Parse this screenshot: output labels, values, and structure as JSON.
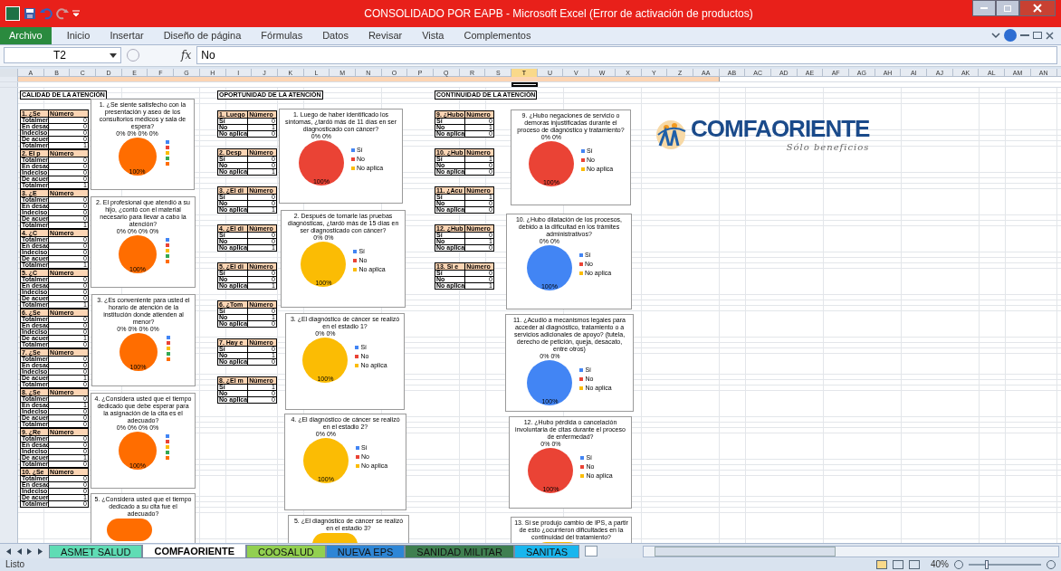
{
  "window": {
    "title": "CONSOLIDADO POR EAPB  -  Microsoft Excel (Error de activación de productos)"
  },
  "ribbon": {
    "tabs": [
      {
        "label": "Archivo",
        "kind": "file"
      },
      {
        "label": "Inicio",
        "kind": "tab"
      },
      {
        "label": "Insertar",
        "kind": "tab"
      },
      {
        "label": "Diseño de página",
        "kind": "tab"
      },
      {
        "label": "Fórmulas",
        "kind": "tab"
      },
      {
        "label": "Datos",
        "kind": "tab"
      },
      {
        "label": "Revisar",
        "kind": "tab"
      },
      {
        "label": "Vista",
        "kind": "tab"
      },
      {
        "label": "Complementos",
        "kind": "tab"
      }
    ]
  },
  "formula_bar": {
    "name_box": "T2",
    "function_button": "fx",
    "value": "No"
  },
  "columns": [
    {
      "label": "A",
      "selected": false
    },
    {
      "label": "B",
      "selected": false
    },
    {
      "label": "C",
      "selected": false
    },
    {
      "label": "D",
      "selected": false
    },
    {
      "label": "E",
      "selected": false
    },
    {
      "label": "F",
      "selected": false
    },
    {
      "label": "G",
      "selected": false
    },
    {
      "label": "H",
      "selected": false
    },
    {
      "label": "I",
      "selected": false
    },
    {
      "label": "J",
      "selected": false
    },
    {
      "label": "K",
      "selected": false
    },
    {
      "label": "L",
      "selected": false
    },
    {
      "label": "M",
      "selected": false
    },
    {
      "label": "N",
      "selected": false
    },
    {
      "label": "O",
      "selected": false
    },
    {
      "label": "P",
      "selected": false
    },
    {
      "label": "Q",
      "selected": false
    },
    {
      "label": "R",
      "selected": false
    },
    {
      "label": "S",
      "selected": false
    },
    {
      "label": "T",
      "selected": true
    },
    {
      "label": "U",
      "selected": false
    },
    {
      "label": "V",
      "selected": false
    },
    {
      "label": "W",
      "selected": false
    },
    {
      "label": "X",
      "selected": false
    },
    {
      "label": "Y",
      "selected": false
    },
    {
      "label": "Z",
      "selected": false
    },
    {
      "label": "AA",
      "selected": false
    },
    {
      "label": "AB",
      "selected": false
    },
    {
      "label": "AC",
      "selected": false
    },
    {
      "label": "AD",
      "selected": false
    },
    {
      "label": "AE",
      "selected": false
    },
    {
      "label": "AF",
      "selected": false
    },
    {
      "label": "AG",
      "selected": false
    },
    {
      "label": "AH",
      "selected": false
    },
    {
      "label": "AI",
      "selected": false
    },
    {
      "label": "AJ",
      "selected": false
    },
    {
      "label": "AK",
      "selected": false
    },
    {
      "label": "AL",
      "selected": false
    },
    {
      "label": "AM",
      "selected": false
    },
    {
      "label": "AN",
      "selected": false
    }
  ],
  "sheet": {
    "sections": [
      {
        "heading": "CALIDAD DE LA ATENCIÓN",
        "tables": [
          {
            "header": "1. ¿Se",
            "count_header": "Número",
            "rows": [
              {
                "label": "Totalmer",
                "value": "0"
              },
              {
                "label": "En desac",
                "value": "0"
              },
              {
                "label": "Indeciso",
                "value": "0"
              },
              {
                "label": "De acuer",
                "value": "0"
              },
              {
                "label": "Totalmer",
                "value": "1"
              }
            ]
          },
          {
            "header": "2. El p",
            "count_header": "Número",
            "rows": [
              {
                "label": "Totalmer",
                "value": "0"
              },
              {
                "label": "En desac",
                "value": "0"
              },
              {
                "label": "Indeciso",
                "value": "0"
              },
              {
                "label": "De acuer",
                "value": "0"
              },
              {
                "label": "Totalmer",
                "value": "1"
              }
            ]
          },
          {
            "header": "3. ¿E",
            "count_header": "Número",
            "rows": [
              {
                "label": "Totalmer",
                "value": "0"
              },
              {
                "label": "En desac",
                "value": "0"
              },
              {
                "label": "Indeciso",
                "value": "0"
              },
              {
                "label": "De acuer",
                "value": "0"
              },
              {
                "label": "Totalmer",
                "value": "1"
              }
            ]
          },
          {
            "header": "4. ¿C",
            "count_header": "Número",
            "rows": [
              {
                "label": "Totalmer",
                "value": "0"
              },
              {
                "label": "En desac",
                "value": "0"
              },
              {
                "label": "Indeciso",
                "value": "0"
              },
              {
                "label": "De acuer",
                "value": "0"
              },
              {
                "label": "Totalmer",
                "value": "1"
              }
            ]
          },
          {
            "header": "5. ¿C",
            "count_header": "Número",
            "rows": [
              {
                "label": "Totalmer",
                "value": "0"
              },
              {
                "label": "En desac",
                "value": "0"
              },
              {
                "label": "Indeciso",
                "value": "0"
              },
              {
                "label": "De acuer",
                "value": "0"
              },
              {
                "label": "Totalmer",
                "value": "1"
              }
            ]
          },
          {
            "header": "6. ¿Se",
            "count_header": "Número",
            "rows": [
              {
                "label": "Totalmer",
                "value": "0"
              },
              {
                "label": "En desac",
                "value": "0"
              },
              {
                "label": "Indeciso",
                "value": "0"
              },
              {
                "label": "De acuer",
                "value": "1"
              },
              {
                "label": "Totalmer",
                "value": "0"
              }
            ]
          },
          {
            "header": "7. ¿Se",
            "count_header": "Número",
            "rows": [
              {
                "label": "Totalmer",
                "value": "0"
              },
              {
                "label": "En desac",
                "value": "0"
              },
              {
                "label": "Indeciso",
                "value": "0"
              },
              {
                "label": "De acuer",
                "value": "1"
              },
              {
                "label": "Totalmer",
                "value": "0"
              }
            ]
          },
          {
            "header": "8. ¿Se",
            "count_header": "Número",
            "rows": [
              {
                "label": "Totalmer",
                "value": "0"
              },
              {
                "label": "En desac",
                "value": "1"
              },
              {
                "label": "Indeciso",
                "value": "0"
              },
              {
                "label": "De acuer",
                "value": "0"
              },
              {
                "label": "Totalmer",
                "value": "0"
              }
            ]
          },
          {
            "header": "9. ¿Re",
            "count_header": "Número",
            "rows": [
              {
                "label": "Totalmer",
                "value": "0"
              },
              {
                "label": "En desac",
                "value": "0"
              },
              {
                "label": "Indeciso",
                "value": "0"
              },
              {
                "label": "De acuer",
                "value": "1"
              },
              {
                "label": "Totalmer",
                "value": "0"
              }
            ]
          },
          {
            "header": "10. ¿Se",
            "count_header": "Número",
            "rows": [
              {
                "label": "Totalmer",
                "value": "0"
              },
              {
                "label": "En desac",
                "value": "0"
              },
              {
                "label": "Indeciso",
                "value": "0"
              },
              {
                "label": "De acuer",
                "value": "1"
              },
              {
                "label": "Totalmer",
                "value": "0"
              }
            ]
          }
        ],
        "charts": [
          {
            "kind": "full",
            "chart_data": {
              "type": "pie",
              "title": "1. ¿Se siente satisfecho con la presentación y aseo de los consultorios médicos y sala de espera?",
              "colors": [
                "#4285f4",
                "#ea4335",
                "#fbbc04",
                "#34a853",
                "#ff6d00"
              ],
              "values": [
                0,
                0,
                0,
                0,
                100
              ],
              "value_labels": [
                "0%",
                "0%",
                "0%",
                "0%",
                "100%"
              ]
            }
          },
          {
            "kind": "full",
            "chart_data": {
              "type": "pie",
              "title": "2. El profesional que atendió a su hijo, ¿contó con el material necesario para llevar a cabo la atención?",
              "colors": [
                "#4285f4",
                "#ea4335",
                "#fbbc04",
                "#34a853",
                "#ff6d00"
              ],
              "values": [
                0,
                0,
                0,
                0,
                100
              ],
              "value_labels": [
                "0%",
                "0%",
                "0%",
                "0%",
                "100%"
              ]
            }
          },
          {
            "kind": "full",
            "chart_data": {
              "type": "pie",
              "title": "3. ¿Es conveniente para usted el horario de atención de la institución donde atienden al menor?",
              "colors": [
                "#4285f4",
                "#ea4335",
                "#fbbc04",
                "#34a853",
                "#ff6d00"
              ],
              "values": [
                0,
                0,
                0,
                0,
                100
              ],
              "value_labels": [
                "0%",
                "0%",
                "0%",
                "0%",
                "100%"
              ]
            }
          },
          {
            "kind": "full",
            "chart_data": {
              "type": "pie",
              "title": "4. ¿Considera usted que el tiempo dedicado que debe esperar para la asignación de la cita es el adecuado?",
              "colors": [
                "#4285f4",
                "#ea4335",
                "#fbbc04",
                "#34a853",
                "#ff6d00"
              ],
              "values": [
                0,
                0,
                0,
                0,
                100
              ],
              "value_labels": [
                "0%",
                "0%",
                "0%",
                "0%",
                "100%"
              ]
            }
          },
          {
            "kind": "cut",
            "title": "5. ¿Considera usted que el tiempo dedicado a su cita fue el adecuado?",
            "color": "#ff6d00"
          }
        ]
      },
      {
        "heading": "OPORTUNIDAD DE LA ATENCIÓN",
        "tables": [
          {
            "header": "1. Luego",
            "count_header": "Número",
            "rows": [
              {
                "label": "Sí",
                "value": "0"
              },
              {
                "label": "No",
                "value": "1"
              },
              {
                "label": "No aplica",
                "value": "0"
              }
            ]
          },
          {
            "header": "2. Desp",
            "count_header": "Número",
            "rows": [
              {
                "label": "Sí",
                "value": "0"
              },
              {
                "label": "No",
                "value": "0"
              },
              {
                "label": "No aplica",
                "value": "1"
              }
            ]
          },
          {
            "header": "3. ¿El di",
            "count_header": "Número",
            "rows": [
              {
                "label": "Sí",
                "value": "0"
              },
              {
                "label": "No",
                "value": "0"
              },
              {
                "label": "No aplica",
                "value": "1"
              }
            ]
          },
          {
            "header": "4. ¿El di",
            "count_header": "Número",
            "rows": [
              {
                "label": "Sí",
                "value": "0"
              },
              {
                "label": "No",
                "value": "0"
              },
              {
                "label": "No aplica",
                "value": "1"
              }
            ]
          },
          {
            "header": "5. ¿El di",
            "count_header": "Número",
            "rows": [
              {
                "label": "Sí",
                "value": "0"
              },
              {
                "label": "No",
                "value": "0"
              },
              {
                "label": "No aplica",
                "value": "1"
              }
            ]
          },
          {
            "header": "6. ¿Tom",
            "count_header": "Número",
            "rows": [
              {
                "label": "Sí",
                "value": "0"
              },
              {
                "label": "No",
                "value": "1"
              },
              {
                "label": "No aplica",
                "value": "0"
              }
            ]
          },
          {
            "header": "7. Hay e",
            "count_header": "Número",
            "rows": [
              {
                "label": "Sí",
                "value": "0"
              },
              {
                "label": "No",
                "value": "1"
              },
              {
                "label": "No aplica",
                "value": "0"
              }
            ]
          },
          {
            "header": "8. ¿El m",
            "count_header": "Número",
            "rows": [
              {
                "label": "Sí",
                "value": "1"
              },
              {
                "label": "No",
                "value": "0"
              },
              {
                "label": "No aplica",
                "value": "0"
              }
            ]
          }
        ],
        "charts": [
          {
            "kind": "full",
            "chart_data": {
              "type": "pie",
              "title": "1. Luego de haber identificado los síntomas, ¿tardó más de 11 días en ser diagnosticado con cáncer?",
              "categories": [
                "Sí",
                "No",
                "No aplica"
              ],
              "colors": [
                "#4285f4",
                "#ea4335",
                "#fbbc04"
              ],
              "values": [
                0,
                100,
                0
              ],
              "value_labels": [
                "0%",
                "100%",
                "0%"
              ]
            }
          },
          {
            "kind": "full",
            "chart_data": {
              "type": "pie",
              "title": "2. Después de tomarle las pruebas diagnósticas, ¿tardó más de 15 días en ser diagnosticado con cáncer?",
              "categories": [
                "Sí",
                "No",
                "No aplica"
              ],
              "colors": [
                "#4285f4",
                "#ea4335",
                "#fbbc04"
              ],
              "values": [
                0,
                0,
                100
              ],
              "value_labels": [
                "0%",
                "0%",
                "100%"
              ]
            }
          },
          {
            "kind": "full",
            "chart_data": {
              "type": "pie",
              "title": "3. ¿El diagnóstico de cáncer se realizó en el estadio 1?",
              "categories": [
                "Sí",
                "No",
                "No aplica"
              ],
              "colors": [
                "#4285f4",
                "#ea4335",
                "#fbbc04"
              ],
              "values": [
                0,
                0,
                100
              ],
              "value_labels": [
                "0%",
                "0%",
                "100%"
              ]
            }
          },
          {
            "kind": "full",
            "chart_data": {
              "type": "pie",
              "title": "4. ¿El diagnóstico de cáncer se realizó en el estadio 2?",
              "categories": [
                "Sí",
                "No",
                "No aplica"
              ],
              "colors": [
                "#4285f4",
                "#ea4335",
                "#fbbc04"
              ],
              "values": [
                0,
                0,
                100
              ],
              "value_labels": [
                "0%",
                "0%",
                "100%"
              ]
            }
          },
          {
            "kind": "cut",
            "title": "5. ¿El diagnóstico de cáncer se realizó en el estadio 3?",
            "color": "#fbbc04"
          }
        ]
      },
      {
        "heading": "CONTINUIDAD DE LA ATENCIÓN",
        "tables": [
          {
            "header": "9. ¿Hubo",
            "count_header": "Número",
            "rows": [
              {
                "label": "Sí",
                "value": "0"
              },
              {
                "label": "No",
                "value": "1"
              },
              {
                "label": "No aplica",
                "value": "0"
              }
            ]
          },
          {
            "header": "10. ¿Hub",
            "count_header": "Número",
            "rows": [
              {
                "label": "Sí",
                "value": "1"
              },
              {
                "label": "No",
                "value": "0"
              },
              {
                "label": "No aplica",
                "value": "0"
              }
            ]
          },
          {
            "header": "11. ¿Acu",
            "count_header": "Número",
            "rows": [
              {
                "label": "Sí",
                "value": "1"
              },
              {
                "label": "No",
                "value": "0"
              },
              {
                "label": "No aplica",
                "value": "0"
              }
            ]
          },
          {
            "header": "12. ¿Hub",
            "count_header": "Número",
            "rows": [
              {
                "label": "Sí",
                "value": "0"
              },
              {
                "label": "No",
                "value": "1"
              },
              {
                "label": "No aplica",
                "value": "0"
              }
            ]
          },
          {
            "header": "13. Si e",
            "count_header": "Número",
            "rows": [
              {
                "label": "Sí",
                "value": "0"
              },
              {
                "label": "No",
                "value": "0"
              },
              {
                "label": "No aplica",
                "value": "1"
              }
            ]
          }
        ],
        "charts": [
          {
            "kind": "full",
            "chart_data": {
              "type": "pie",
              "title": "9. ¿Hubo negaciones de servicio o demoras injustificadas durante el proceso de diagnóstico y tratamiento?",
              "categories": [
                "Sí",
                "No",
                "No aplica"
              ],
              "colors": [
                "#4285f4",
                "#ea4335",
                "#fbbc04"
              ],
              "values": [
                0,
                100,
                0
              ],
              "value_labels": [
                "0%",
                "100%",
                "0%"
              ]
            }
          },
          {
            "kind": "full",
            "chart_data": {
              "type": "pie",
              "title": "10. ¿Hubo dilatación de los procesos, debido a la dificultad en los trámites administrativos?",
              "categories": [
                "Sí",
                "No",
                "No aplica"
              ],
              "colors": [
                "#4285f4",
                "#ea4335",
                "#fbbc04"
              ],
              "values": [
                100,
                0,
                0
              ],
              "value_labels": [
                "100%",
                "0%",
                "0%"
              ]
            }
          },
          {
            "kind": "full",
            "chart_data": {
              "type": "pie",
              "title": "11. ¿Acudió a mecanismos legales para acceder al diagnóstico, tratamiento o a servicios adicionales de apoyo? (tutela, derecho de petición, queja, desacato, entre otros)",
              "categories": [
                "Sí",
                "No",
                "No aplica"
              ],
              "colors": [
                "#4285f4",
                "#ea4335",
                "#fbbc04"
              ],
              "values": [
                100,
                0,
                0
              ],
              "value_labels": [
                "100%",
                "0%",
                "0%"
              ]
            }
          },
          {
            "kind": "full",
            "chart_data": {
              "type": "pie",
              "title": "12. ¿Hubo pérdida o cancelación involuntaria de citas durante el proceso de enfermedad?",
              "categories": [
                "Sí",
                "No",
                "No aplica"
              ],
              "colors": [
                "#4285f4",
                "#ea4335",
                "#fbbc04"
              ],
              "values": [
                0,
                100,
                0
              ],
              "value_labels": [
                "0%",
                "100%",
                "0%"
              ]
            }
          },
          {
            "kind": "cut",
            "title": "13. Si se produjo cambio de IPS, a partir de esto ¿ocurrieron dificultades en la continuidad del tratamiento?",
            "color": "#fbbc04"
          }
        ]
      }
    ],
    "logo": {
      "name": "COMFAORIENTE",
      "tagline": "Sólo beneficios"
    }
  },
  "sheet_tabs": [
    {
      "label": "ASMET SALUD",
      "color": "#5fdcb4",
      "selected": false
    },
    {
      "label": "COMFAORIENTE",
      "color": "#ffffff",
      "selected": true
    },
    {
      "label": "COOSALUD",
      "color": "#92d050",
      "selected": false
    },
    {
      "label": "NUEVA EPS",
      "color": "#2e86d6",
      "selected": false
    },
    {
      "label": "SANIDAD MILITAR",
      "color": "#3f7f50",
      "selected": false
    },
    {
      "label": "SANITAS",
      "color": "#19b6ee",
      "selected": false
    }
  ],
  "status_bar": {
    "status": "Listo",
    "zoom": "40%",
    "zoom_slider": {
      "level": 0.22
    }
  }
}
